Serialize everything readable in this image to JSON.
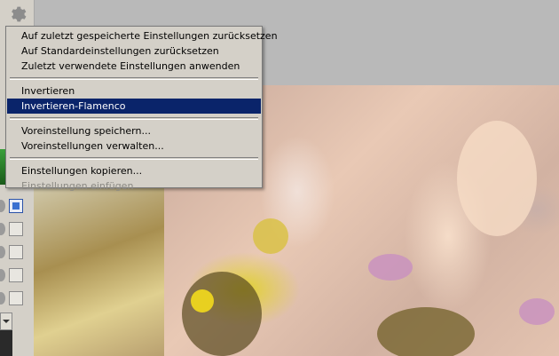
{
  "panel": {
    "icons": [
      "gear-icon",
      "checkbox-icon"
    ],
    "accent_color": "#0a246a"
  },
  "context_menu": {
    "items": [
      {
        "label": "Auf zuletzt gespeicherte Einstellungen zurücksetzen",
        "state": "normal"
      },
      {
        "label": "Auf Standardeinstellungen zurücksetzen",
        "state": "normal"
      },
      {
        "label": "Zuletzt verwendete Einstellungen anwenden",
        "state": "normal"
      },
      {
        "label": "Invertieren",
        "state": "normal"
      },
      {
        "label": "Invertieren-Flamenco",
        "state": "highlighted"
      },
      {
        "label": "Voreinstellung speichern...",
        "state": "normal"
      },
      {
        "label": "Voreinstellungen verwalten...",
        "state": "normal"
      },
      {
        "label": "Einstellungen kopieren...",
        "state": "normal"
      },
      {
        "label": "Einstellungen einfügen",
        "state": "disabled"
      }
    ],
    "highlight_color": "#0a246a",
    "disabled_color": "#8c8a84"
  }
}
